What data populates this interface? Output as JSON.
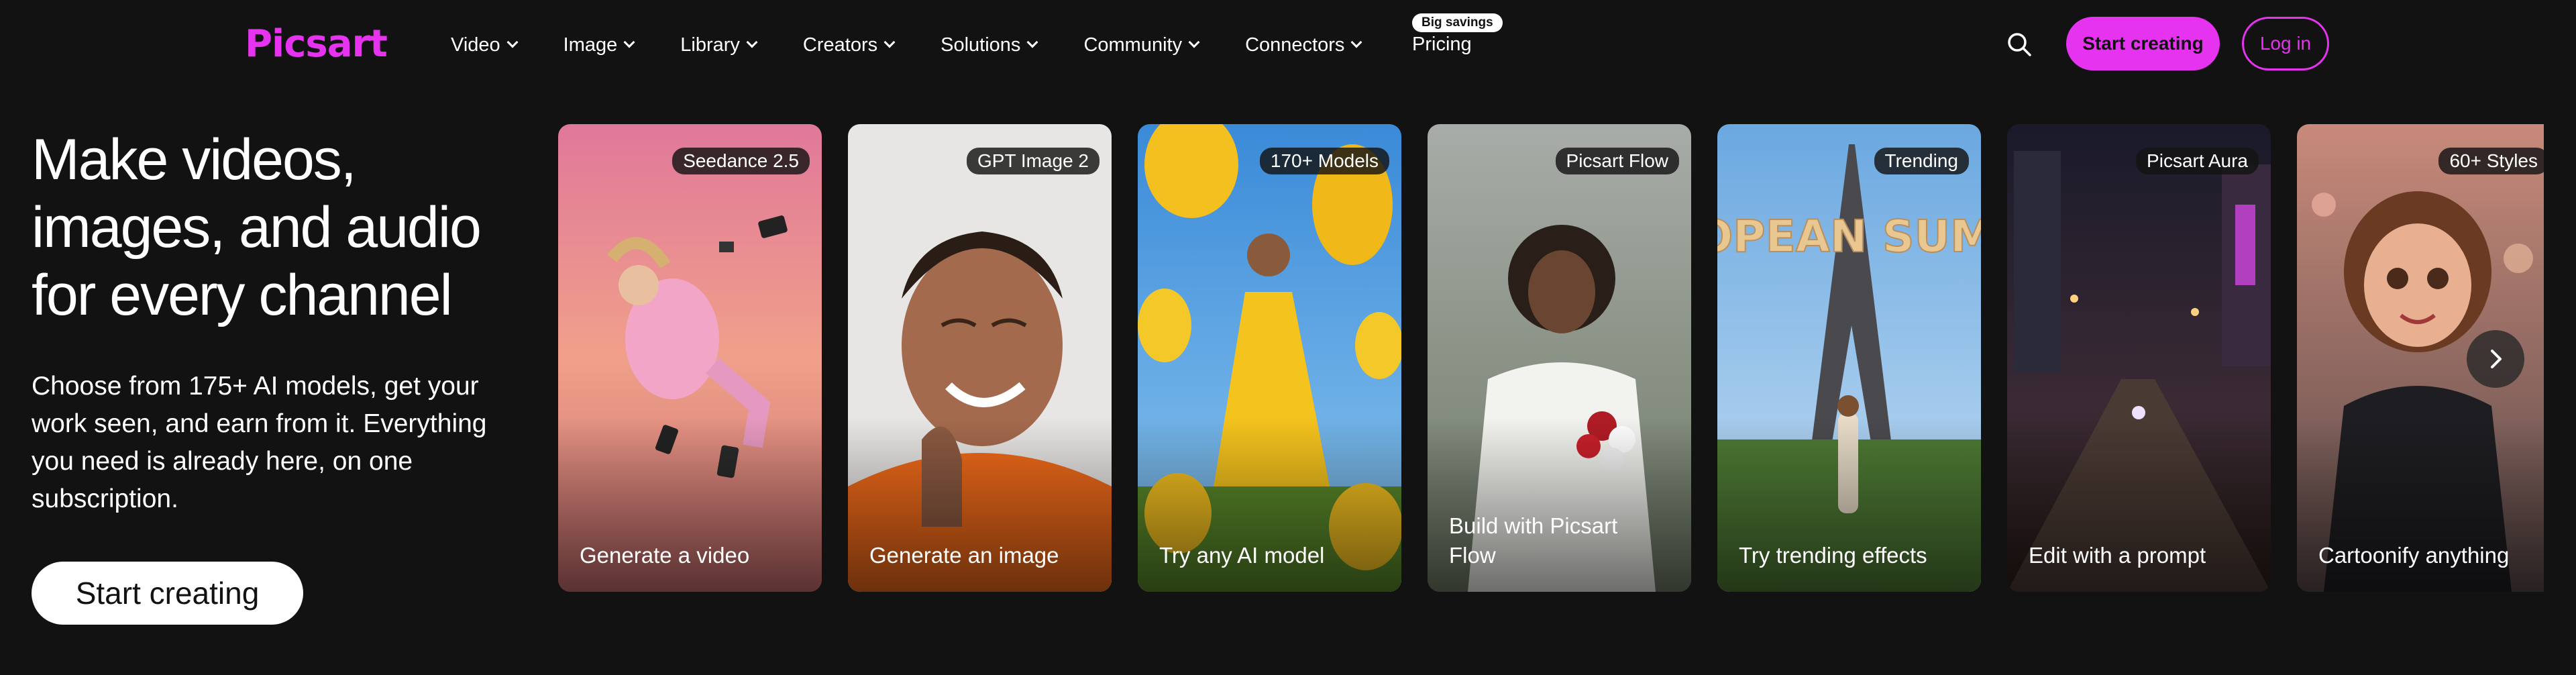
{
  "nav": {
    "logo": "Picsart",
    "items": [
      {
        "label": "Video"
      },
      {
        "label": "Image"
      },
      {
        "label": "Library"
      },
      {
        "label": "Creators"
      },
      {
        "label": "Solutions"
      },
      {
        "label": "Community"
      },
      {
        "label": "Connectors"
      }
    ],
    "pricing_badge": "Big savings",
    "pricing_label": "Pricing",
    "start_label": "Start creating",
    "login_label": "Log in"
  },
  "hero": {
    "title": "Make videos, images, and audio for every channel",
    "subtitle": "Choose from 175+ AI models, get your work seen, and earn from it. Everything you need is already here, on one subscription.",
    "cta_label": "Start creating"
  },
  "cards": [
    {
      "tag": "Seedance 2.5",
      "caption": "Generate a video"
    },
    {
      "tag": "GPT Image 2",
      "caption": "Generate an image"
    },
    {
      "tag": "170+ Models",
      "caption": "Try any AI model"
    },
    {
      "tag": "Picsart Flow",
      "caption": "Build with Picsart Flow"
    },
    {
      "tag": "Trending",
      "caption": "Try trending effects",
      "art_text": "EUROPEAN SUMMER"
    },
    {
      "tag": "Picsart Aura",
      "caption": "Edit with a prompt"
    },
    {
      "tag": "60+ Styles",
      "caption": "Cartoonify anything"
    }
  ],
  "colors": {
    "background": "#121212",
    "accent": "#e633f0",
    "text": "#ffffff"
  },
  "icons": {
    "search": "search-icon",
    "dropdown": "chevron-down-icon",
    "carousel_next": "chevron-right-icon"
  }
}
